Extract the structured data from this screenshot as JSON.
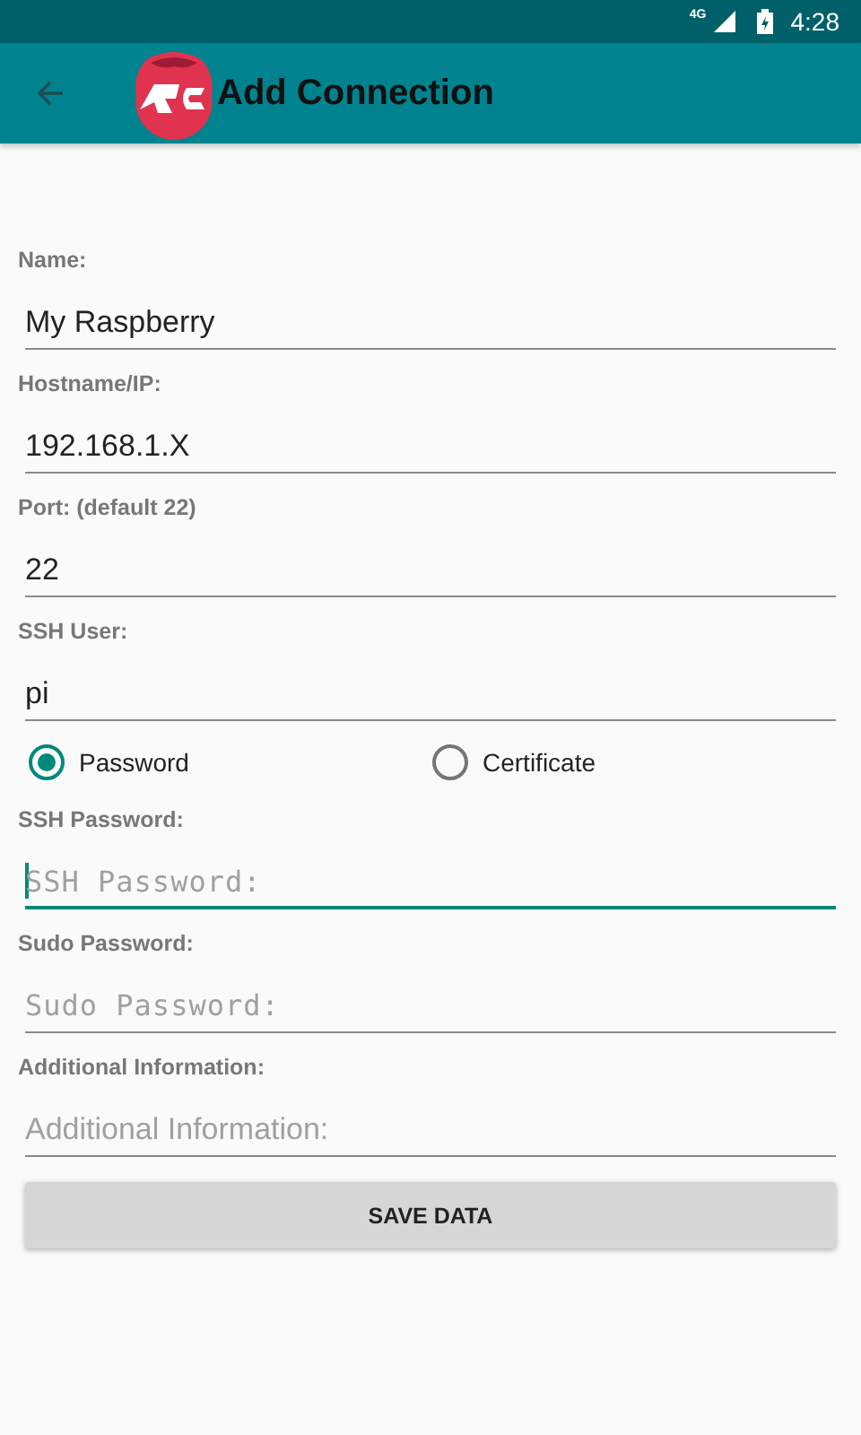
{
  "status_bar": {
    "network": "4G",
    "time": "4:28"
  },
  "toolbar": {
    "title": "Add Connection"
  },
  "form": [
    {
      "kind": "field",
      "label": "Name:",
      "value": "My Raspberry",
      "focused": false
    },
    {
      "kind": "field",
      "label": "Hostname/IP:",
      "value": "192.168.1.X",
      "focused": false
    },
    {
      "kind": "field",
      "label": "Port: (default 22)",
      "value": "22",
      "focused": false
    },
    {
      "kind": "field",
      "label": "SSH User:",
      "value": "pi",
      "focused": false
    },
    {
      "kind": "radio_group",
      "options": [
        {
          "label": "Password",
          "selected": true
        },
        {
          "label": "Certificate",
          "selected": false
        }
      ]
    },
    {
      "kind": "password",
      "label": "SSH Password:",
      "placeholder": "SSH Password:",
      "focused": true
    },
    {
      "kind": "password",
      "label": "Sudo Password:",
      "placeholder": "Sudo Password:",
      "focused": false
    },
    {
      "kind": "field",
      "label": "Additional Information:",
      "placeholder": "Additional Information:",
      "focused": false
    }
  ],
  "button": "SAVE DATA"
}
